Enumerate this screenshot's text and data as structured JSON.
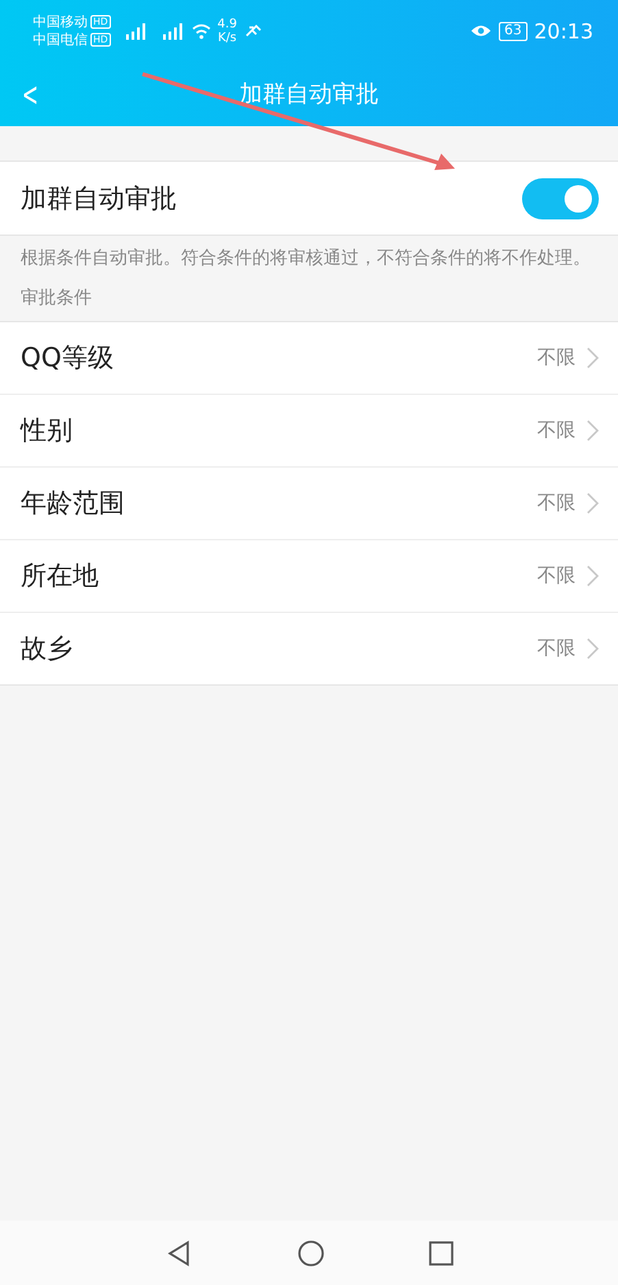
{
  "status_bar": {
    "carriers": [
      {
        "name": "中国移动",
        "badge": "HD"
      },
      {
        "name": "中国电信",
        "badge": "HD"
      }
    ],
    "speed": "4.9",
    "speed_unit": "K/s",
    "battery": "63",
    "time": "20:13"
  },
  "header": {
    "back": "<",
    "title": "加群自动审批"
  },
  "toggle_row": {
    "label": "加群自动审批",
    "on": true
  },
  "description": "根据条件自动审批。符合条件的将审核通过，不符合条件的将不作处理。",
  "section_title": "审批条件",
  "conditions": [
    {
      "label": "QQ等级",
      "value": "不限"
    },
    {
      "label": "性别",
      "value": "不限"
    },
    {
      "label": "年龄范围",
      "value": "不限"
    },
    {
      "label": "所在地",
      "value": "不限"
    },
    {
      "label": "故乡",
      "value": "不限"
    }
  ]
}
